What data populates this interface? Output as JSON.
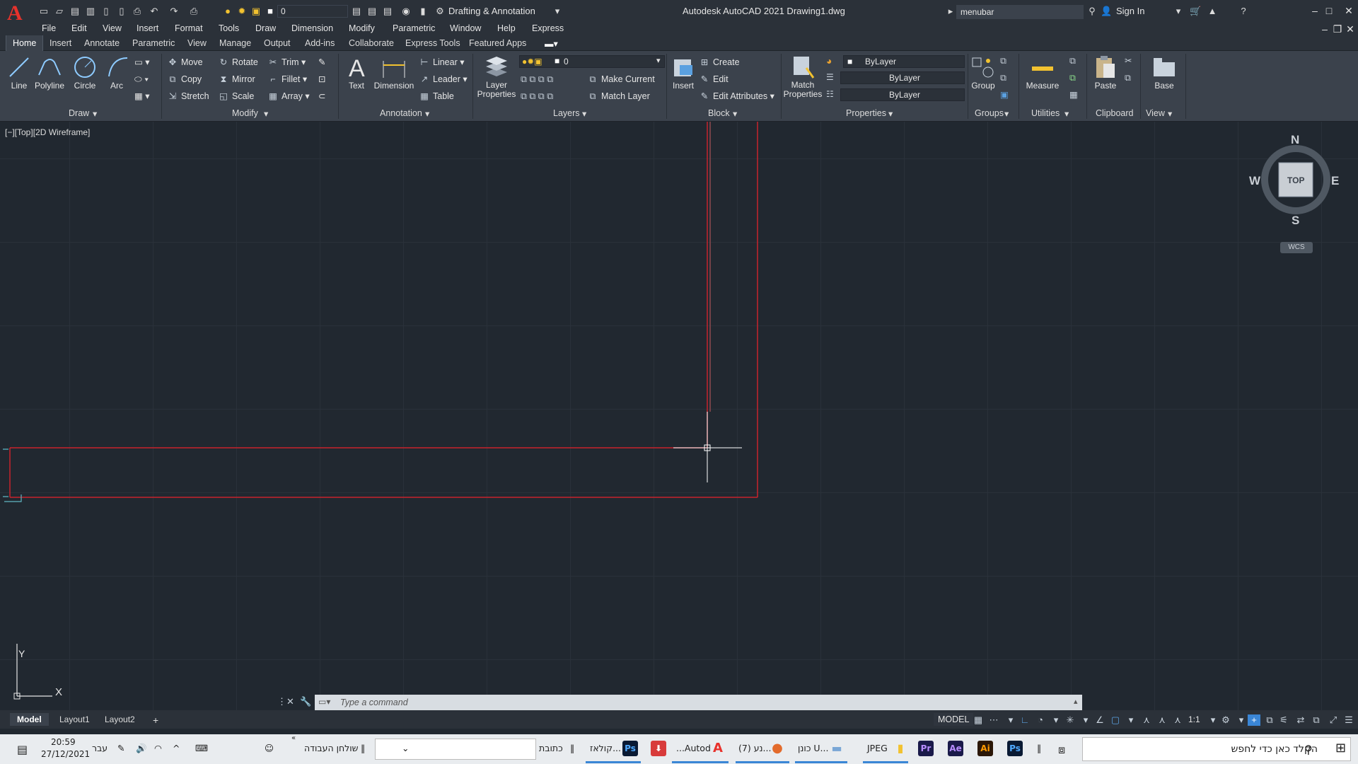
{
  "titlebar": {
    "logo_letter": "A",
    "quick_layer": "0",
    "workspace": "Drafting & Annotation",
    "app_title": "Autodesk AutoCAD 2021   Drawing1.dwg",
    "search_value": "menubar",
    "sign_in": "Sign In"
  },
  "menubar": [
    "File",
    "Edit",
    "View",
    "Insert",
    "Format",
    "Tools",
    "Draw",
    "Dimension",
    "Modify",
    "Parametric",
    "Window",
    "Help",
    "Express"
  ],
  "tabs": [
    "Home",
    "Insert",
    "Annotate",
    "Parametric",
    "View",
    "Manage",
    "Output",
    "Add-ins",
    "Collaborate",
    "Express Tools",
    "Featured Apps"
  ],
  "ribbon": {
    "draw": {
      "title": "Draw",
      "line": "Line",
      "polyline": "Polyline",
      "circle": "Circle",
      "arc": "Arc"
    },
    "modify": {
      "title": "Modify",
      "move": "Move",
      "rotate": "Rotate",
      "trim": "Trim",
      "copy": "Copy",
      "mirror": "Mirror",
      "fillet": "Fillet",
      "stretch": "Stretch",
      "scale": "Scale",
      "array": "Array"
    },
    "annotation": {
      "title": "Annotation",
      "text": "Text",
      "dimension": "Dimension",
      "linear": "Linear",
      "leader": "Leader",
      "table": "Table"
    },
    "layers": {
      "title": "Layers",
      "layer_properties": "Layer Properties",
      "current_layer": "0",
      "make_current": "Make Current",
      "match_layer": "Match Layer"
    },
    "block": {
      "title": "Block",
      "insert": "Insert",
      "create": "Create",
      "edit": "Edit",
      "edit_attributes": "Edit Attributes"
    },
    "properties": {
      "title": "Properties",
      "match_properties": "Match Properties",
      "color": "ByLayer",
      "linetype": "ByLayer",
      "lineweight": "ByLayer"
    },
    "groups": {
      "title": "Groups",
      "group": "Group"
    },
    "utilities": {
      "title": "Utilities",
      "measure": "Measure"
    },
    "clipboard": {
      "title": "Clipboard",
      "paste": "Paste"
    },
    "view": {
      "title": "View",
      "base": "Base"
    }
  },
  "viewport": {
    "label": "[−][Top][2D Wireframe]",
    "viewcube": {
      "n": "N",
      "s": "S",
      "e": "E",
      "w": "W",
      "face": "TOP",
      "wcs": "WCS"
    },
    "ucs": {
      "x": "X",
      "y": "Y"
    }
  },
  "command": {
    "placeholder": "Type a command"
  },
  "layout_tabs": [
    "Model",
    "Layout1",
    "Layout2"
  ],
  "status": {
    "mode": "MODEL",
    "scale": "1:1"
  },
  "taskbar": {
    "time": "20:59",
    "date": "27/12/2021",
    "lang": "עבר",
    "desktop": "שולחן העבודה",
    "address_label": "כתובת",
    "apps": [
      {
        "label": "קולאז...",
        "icon": "Ps",
        "color": "#0a1a34"
      },
      {
        "label": "",
        "icon": "⬇",
        "color": "#d83b3b"
      },
      {
        "label": "...Autod",
        "icon": "A",
        "color": "#e8322c"
      },
      {
        "label": "(7) נע...",
        "icon": "●",
        "color": "#e36b2c"
      },
      {
        "label": "כונן U...",
        "icon": "▬",
        "color": "#7aa7d6"
      },
      {
        "label": "JPEG",
        "icon": "▮",
        "color": "#f2c230"
      },
      {
        "label": "",
        "icon": "Pr",
        "color": "#1a1a4a"
      },
      {
        "label": "",
        "icon": "Ae",
        "color": "#1a1a4a"
      },
      {
        "label": "",
        "icon": "Ai",
        "color": "#2b1707"
      },
      {
        "label": "",
        "icon": "Ps",
        "color": "#0a1a34"
      }
    ],
    "search": "הקלד כאן כדי לחפש"
  },
  "colors": {
    "canvas": "#212830",
    "drawing_lines": "#c8232c",
    "ribbon": "#3b424c",
    "taskbar": "#e9ecef"
  }
}
